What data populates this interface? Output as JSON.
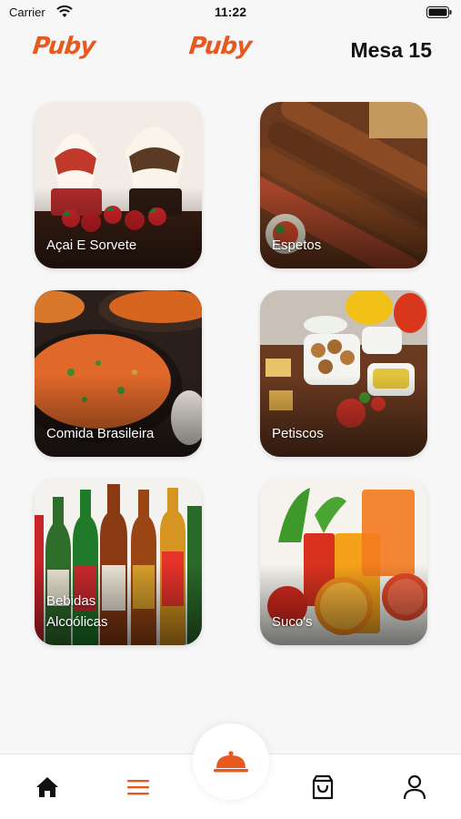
{
  "status_bar": {
    "carrier": "Carrier",
    "time": "11:22"
  },
  "header": {
    "logo_left": "Puby",
    "logo_center": "Puby",
    "table": "Mesa 15"
  },
  "categories": [
    {
      "label": "Açai E Sorvete",
      "art": "ice-cream"
    },
    {
      "label": "Espetos",
      "art": "skewers"
    },
    {
      "label": "Comida Brasileira",
      "art": "stew"
    },
    {
      "label": "Petiscos",
      "art": "snacks"
    },
    {
      "label": "Bebidas\nAlcoólicas",
      "art": "beer-bottles"
    },
    {
      "label": "Suco's",
      "art": "juices"
    }
  ],
  "nav": {
    "items": [
      {
        "name": "home-icon"
      },
      {
        "name": "menu-icon",
        "active": true
      },
      {
        "name": "cloche-icon",
        "center": true
      },
      {
        "name": "shopping-bag-icon"
      },
      {
        "name": "user-icon"
      }
    ]
  },
  "colors": {
    "brand": "#e65a1f",
    "text": "#111111",
    "background": "#f7f7f7"
  }
}
